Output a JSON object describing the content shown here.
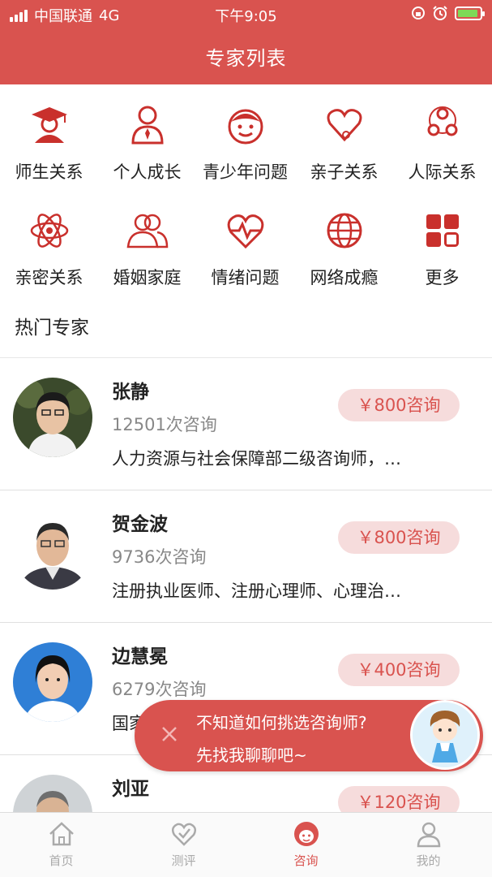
{
  "status_bar": {
    "carrier": "中国联通",
    "network": "4G",
    "time": "下午9:05"
  },
  "header": {
    "title": "专家列表"
  },
  "categories": [
    {
      "label": "师生关系",
      "icon": "graduate-icon"
    },
    {
      "label": "个人成长",
      "icon": "person-tie-icon"
    },
    {
      "label": "青少年问题",
      "icon": "boy-face-icon"
    },
    {
      "label": "亲子关系",
      "icon": "heart-stethoscope-icon"
    },
    {
      "label": "人际关系",
      "icon": "network-triangle-icon"
    },
    {
      "label": "亲密关系",
      "icon": "atom-icon"
    },
    {
      "label": "婚姻家庭",
      "icon": "two-people-icon"
    },
    {
      "label": "情绪问题",
      "icon": "heartbeat-icon"
    },
    {
      "label": "网络成瘾",
      "icon": "globe-icon"
    },
    {
      "label": "更多",
      "icon": "grid-more-icon"
    }
  ],
  "section_title": "热门专家",
  "experts": [
    {
      "name": "张静",
      "count": "12501次咨询",
      "desc": "人力资源与社会保障部二级咨询师，…",
      "price": "￥800咨询"
    },
    {
      "name": "贺金波",
      "count": "9736次咨询",
      "desc": "注册执业医师、注册心理师、心理治…",
      "price": "￥800咨询"
    },
    {
      "name": "边慧冕",
      "count": "6279次咨询",
      "desc": "国家",
      "price": "￥400咨询"
    },
    {
      "name": "刘亚",
      "count": "",
      "desc": "",
      "price": "￥120咨询"
    }
  ],
  "prompt": {
    "line1": "不知道如何挑选咨询师?",
    "line2": "先找我聊聊吧~"
  },
  "tabs": [
    {
      "label": "首页",
      "icon": "home-icon"
    },
    {
      "label": "测评",
      "icon": "heart-check-icon"
    },
    {
      "label": "咨询",
      "icon": "consult-avatar-icon"
    },
    {
      "label": "我的",
      "icon": "user-icon"
    }
  ],
  "active_tab": 2,
  "colors": {
    "brand": "#d9534f",
    "price_bg": "#f6dcdc"
  }
}
